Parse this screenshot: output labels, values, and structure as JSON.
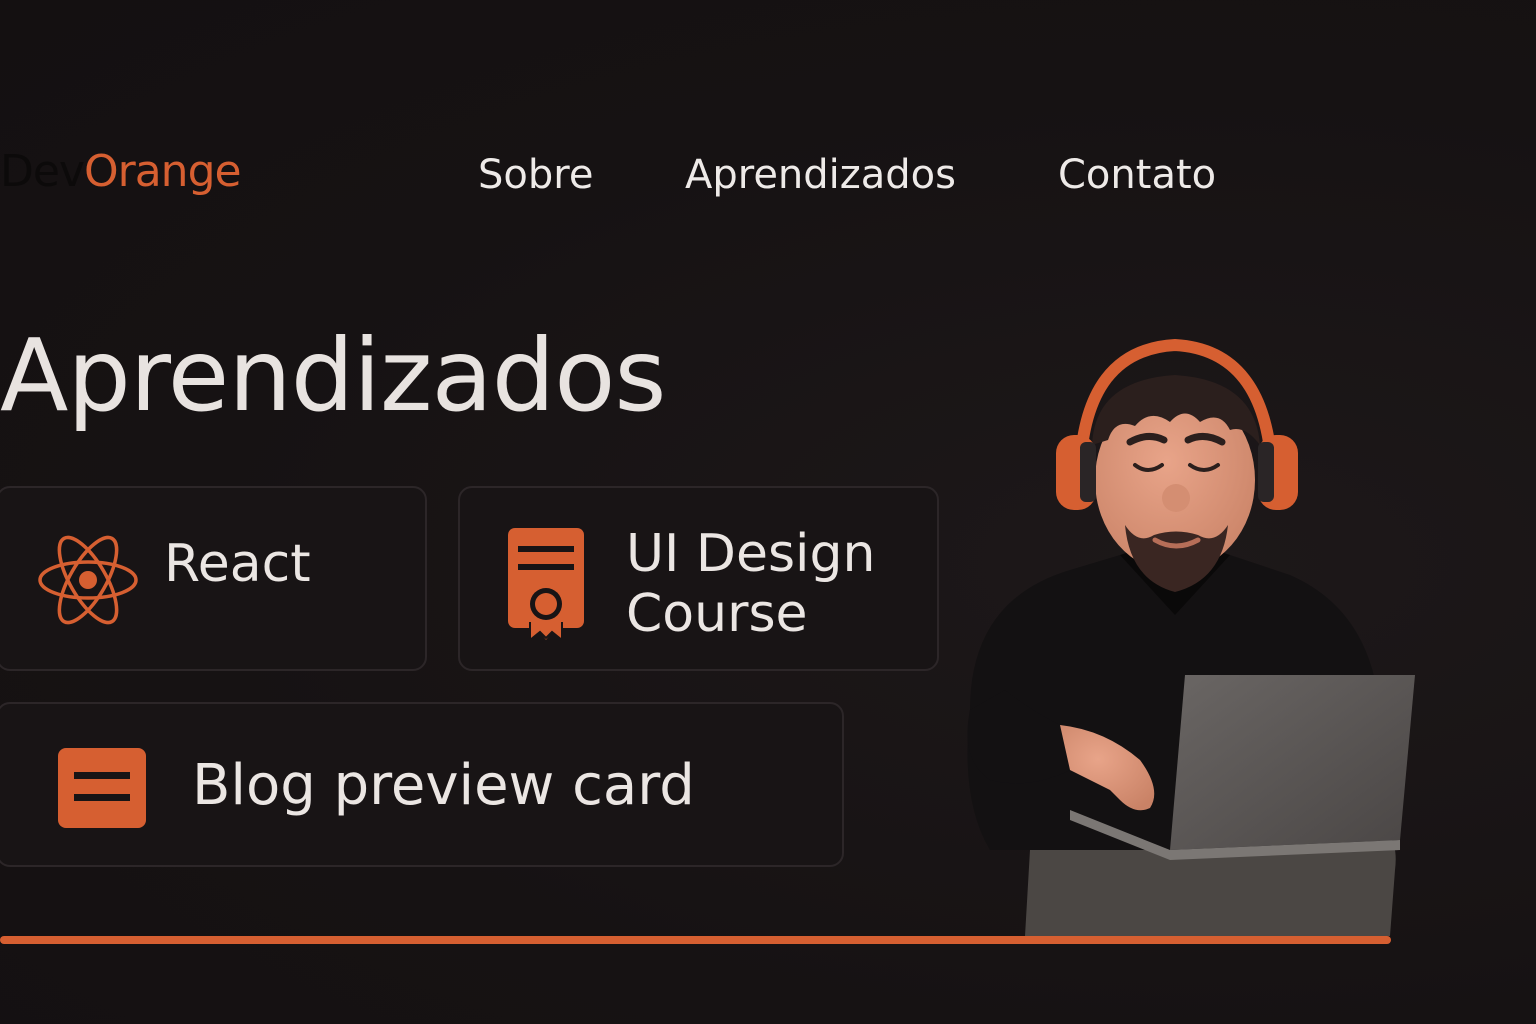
{
  "brand": {
    "part1": "Dev",
    "part2": "Orange"
  },
  "nav": {
    "items": [
      "Sobre",
      "Aprendizados",
      "Contato"
    ]
  },
  "main": {
    "title": "Aprendizados",
    "cards": [
      {
        "label": "React",
        "icon": "react-atom-icon"
      },
      {
        "label": "UI Design Course",
        "icon": "certificate-icon"
      },
      {
        "label": "Blog preview card",
        "icon": "document-lines-icon"
      }
    ]
  },
  "illustration": {
    "subject": "developer-with-headphones-and-laptop"
  },
  "colors": {
    "accent": "#d65f31",
    "background": "#161213",
    "text": "#eeeae8",
    "card_border": "#2c2628"
  }
}
